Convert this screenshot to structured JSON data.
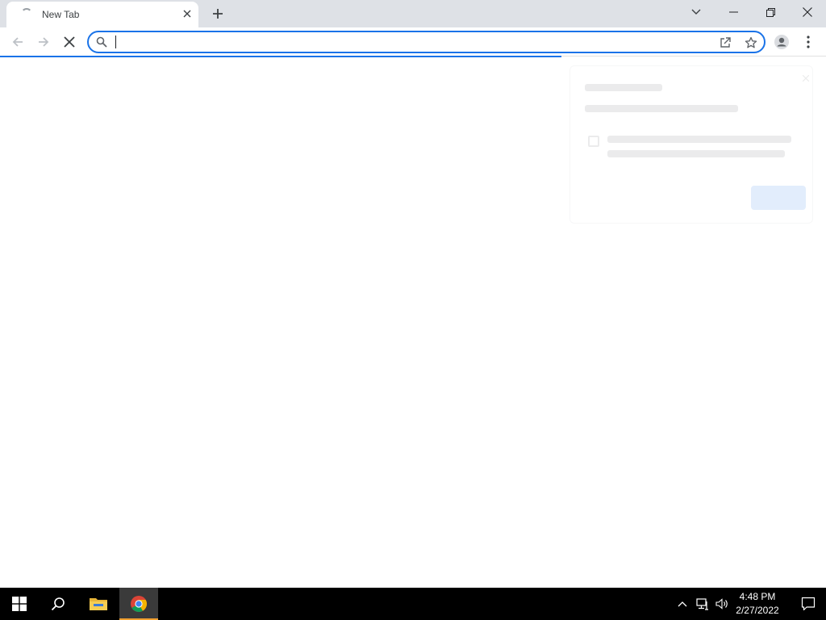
{
  "browser": {
    "tab": {
      "title": "New Tab",
      "loading": true
    },
    "omnibox": {
      "value": "",
      "placeholder": ""
    },
    "load_progress": 0.68
  },
  "taskbar": {
    "clock": {
      "time": "4:48 PM",
      "date": "2/27/2022"
    },
    "pinned": [
      "start-button",
      "search-button",
      "file-explorer",
      "chrome"
    ],
    "active_app": "chrome"
  },
  "colors": {
    "tabstrip_bg": "#dee1e6",
    "accent": "#1a73e8",
    "taskbar_bg": "#000000",
    "taskbar_active_underline": "#f0a030"
  }
}
